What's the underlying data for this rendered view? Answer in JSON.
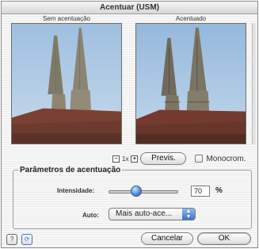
{
  "window": {
    "title": "Acentuar (USM)"
  },
  "previews": {
    "left_label": "Sem acentuação",
    "right_label": "Acentuado"
  },
  "zoom": {
    "level": "1x"
  },
  "buttons": {
    "preview": "Previs.",
    "cancel": "Cancelar",
    "ok": "OK"
  },
  "monochrome": {
    "label": "Monocrom.",
    "checked": false
  },
  "params": {
    "group_title": "Parâmetros de acentuação",
    "intensity_label": "Intensidade:",
    "intensity_value": "70",
    "intensity_fraction": 0.4,
    "intensity_unit": "%",
    "auto_label": "Auto:",
    "auto_value": "Mais auto-ace..."
  },
  "icons": {
    "zoom_out": "zoom-out-icon",
    "zoom_in": "zoom-in-icon",
    "help": "help-icon",
    "reset": "reset-icon"
  },
  "colors": {
    "sky": "#a9c6e3",
    "stone": "#8a8472",
    "roof": "#7a3e34",
    "accent": "#3c74c9"
  }
}
